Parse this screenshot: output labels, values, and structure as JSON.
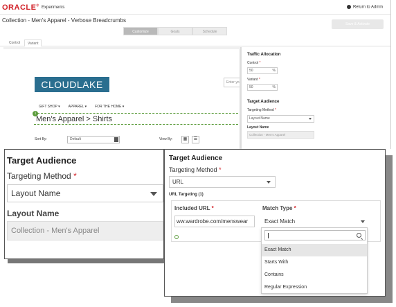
{
  "topbar": {
    "logo": "ORACLE",
    "app_name": "Experiments",
    "return_label": "Return to Admin"
  },
  "page": {
    "title": "Collection - Men's Apparel - Verbose Breadcrumbs",
    "save_label": "Save & Activate"
  },
  "modes": [
    "Customize",
    "Goals",
    "Schedule"
  ],
  "variant_tabs": [
    "Control",
    "Variant"
  ],
  "preview": {
    "logo": "CLOUDLAKE",
    "search_placeholder": "Enter yo",
    "nav": [
      "GIFT SHOP ▾",
      "APPAREL ▾",
      "FOR THE HOME ▾"
    ],
    "breadcrumb": "Men's Apparel > Shirts",
    "sort_label": "Sort By:",
    "sort_value": "Default",
    "view_label": "View By:"
  },
  "right_panel": {
    "traffic_title": "Traffic Allocation",
    "control_label": "Control",
    "control_value": "50",
    "variant_label": "Variant",
    "variant_value": "50",
    "percent": "%",
    "audience_title": "Target Audience",
    "method_label": "Targeting Method",
    "method_value": "Layout Name",
    "layout_label": "Layout Name",
    "layout_value": "Collection - Men's Apparel",
    "required": "*"
  },
  "zoom_left": {
    "title": "Target Audience",
    "method_label": "Targeting Method",
    "method_value": "Layout Name",
    "layout_label": "Layout Name",
    "layout_value": "Collection - Men's Apparel",
    "required": "*"
  },
  "zoom_right": {
    "title": "Target Audience",
    "method_label": "Targeting Method",
    "method_value": "URL",
    "url_targeting": "URL Targeting (1)",
    "included_url_label": "Included URL",
    "included_url_value": "ww.wardrobe.com/menswear",
    "match_type_label": "Match Type",
    "match_type_value": "Exact Match",
    "required": "*",
    "options": [
      "Exact Match",
      "Starts With",
      "Contains",
      "Regular Expression"
    ]
  }
}
